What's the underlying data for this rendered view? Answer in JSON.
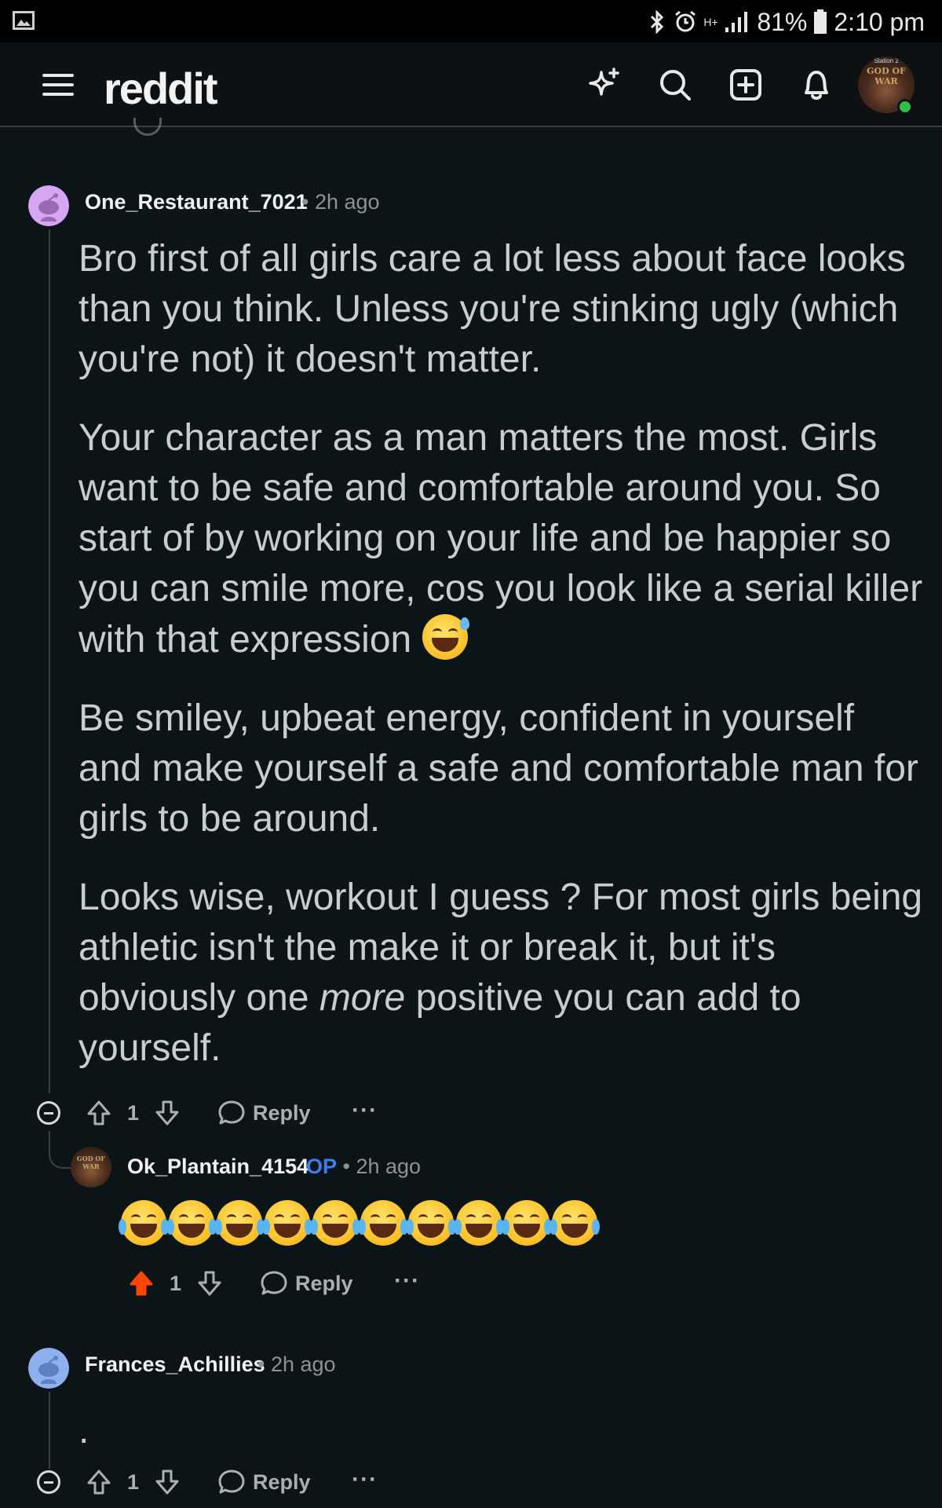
{
  "status_bar": {
    "battery": "81%",
    "time": "2:10 pm",
    "network": "H+"
  },
  "header": {
    "logo": "reddit",
    "icons": [
      "menu-icon",
      "sparkle-icon",
      "search-icon",
      "create-post-icon",
      "notifications-icon"
    ],
    "avatar_text_small": "Station 2",
    "avatar_text": "GOD OF WAR"
  },
  "comments": [
    {
      "username": "One_Restaurant_7021",
      "time": "2h ago",
      "paragraphs": [
        "Bro first of all girls care a lot less about face looks than you think. Unless you're stinking ugly (which you're not) it doesn't matter.",
        "Your character as a man matters the most. Girls want to be safe and comfortable around you. So start of by working on your life and be happier so you can smile more, cos you look like a serial killer with that expression",
        "Be smiley, upbeat energy, confident in yourself and make yourself a safe and comfortable man for girls to be around."
      ],
      "last_paragraph": {
        "before": "Looks wise, workout I guess ? For most girls being athletic isn't the make it or break it, but it's obviously one ",
        "emphasis": "more",
        "after": " positive you can add to yourself."
      },
      "votes": "1",
      "reply_label": "Reply",
      "more_label": "···",
      "replies": [
        {
          "username": "Ok_Plantain_4154",
          "op_badge": "OP",
          "time": "2h ago",
          "emoji_count": 10,
          "votes": "1",
          "upvoted": true,
          "reply_label": "Reply",
          "more_label": "···"
        }
      ]
    },
    {
      "username": "Frances_Achillies",
      "time": "2h ago",
      "body": ".",
      "votes": "1",
      "reply_label": "Reply",
      "more_label": "···"
    }
  ],
  "colors": {
    "background": "#0b1416",
    "upvote_active": "#ff4500",
    "op_badge": "#3d7ee8",
    "avatar_1": "#d7a6f2",
    "avatar_3": "#8fb0ee"
  }
}
